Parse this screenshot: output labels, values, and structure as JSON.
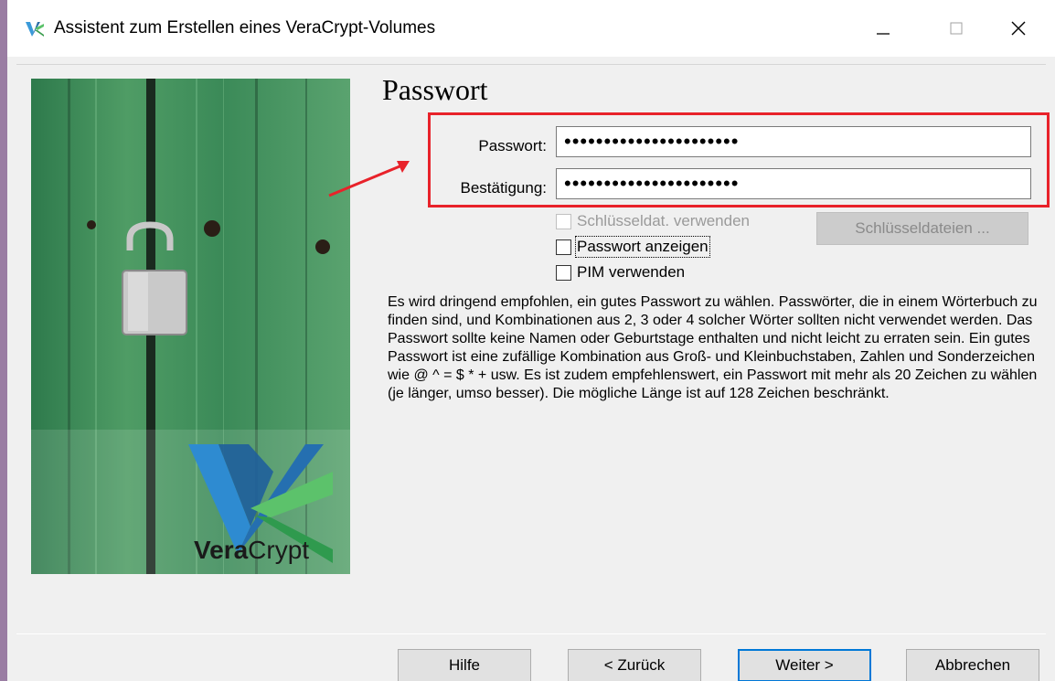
{
  "window": {
    "title": "Assistent zum Erstellen eines VeraCrypt-Volumes",
    "icon": "veracrypt-app-icon"
  },
  "page": {
    "title": "Passwort"
  },
  "password_field": {
    "label": "Passwort:",
    "value": "••••••••••••••••••••••"
  },
  "confirm_field": {
    "label": "Bestätigung:",
    "value": "••••••••••••••••••••••"
  },
  "options": {
    "use_keyfiles": {
      "label": "Schlüsseldat. verwenden",
      "checked": false,
      "enabled": false
    },
    "show_password": {
      "label": "Passwort anzeigen",
      "checked": false
    },
    "use_pim": {
      "label": "PIM verwenden",
      "checked": false
    }
  },
  "keyfiles_button": {
    "label": "Schlüsseldateien ...",
    "enabled": false
  },
  "info_text": "Es wird dringend empfohlen, ein gutes Passwort zu wählen. Passwörter, die in einem Wörterbuch zu finden sind, und Kombinationen aus 2, 3 oder 4 solcher Wörter sollten nicht verwendet werden. Das Passwort sollte keine Namen oder Geburtstage enthalten und nicht leicht zu erraten sein. Ein gutes Passwort ist eine zufällige Kombination aus Groß- und Kleinbuchstaben, Zahlen und Sonderzeichen wie @ ^ = $ * + usw. Es ist zudem empfehlenswert, ein Passwort mit mehr als 20 Zeichen zu wählen (je länger, umso besser). Die mögliche Länge ist auf 128 Zeichen beschränkt.",
  "branding": {
    "name_bold": "Vera",
    "name_regular": "Crypt"
  },
  "buttons": {
    "help": "Hilfe",
    "back": "< Zurück",
    "next": "Weiter >",
    "cancel": "Abbrechen"
  },
  "colors": {
    "highlight": "#e8222a",
    "accent": "#0078d7",
    "panel_green": "#3d8f5a"
  }
}
